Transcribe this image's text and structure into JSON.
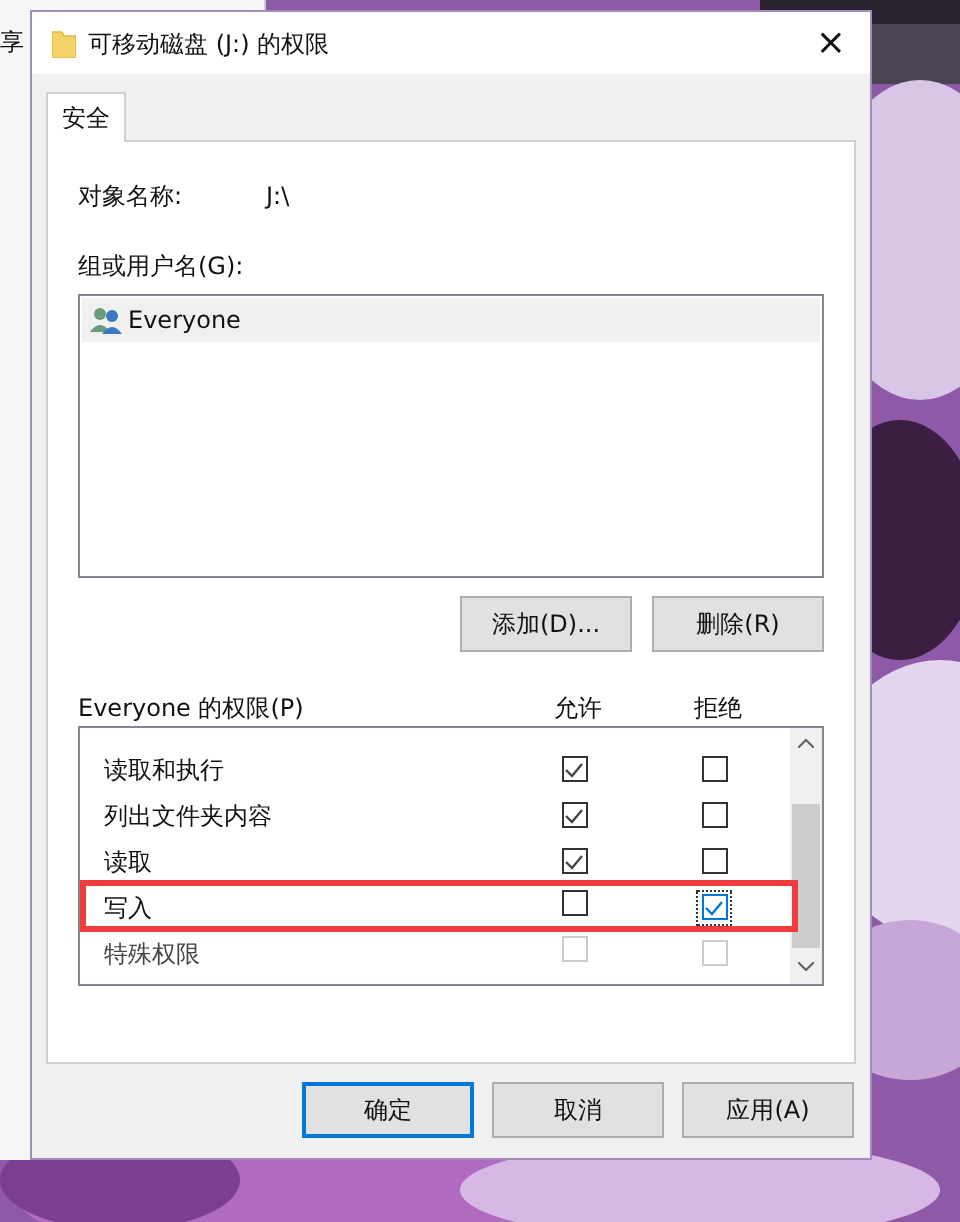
{
  "background_window": {
    "label": "享"
  },
  "dialog": {
    "title": "可移动磁盘 (J:) 的权限",
    "close": "×"
  },
  "tabs": [
    {
      "label": "安全",
      "selected": true
    }
  ],
  "object_name": {
    "label": "对象名称:",
    "value": "J:\\"
  },
  "group": {
    "label": "组或用户名(G):",
    "users": [
      {
        "name": "Everyone",
        "selected": true
      }
    ],
    "buttons": [
      "添加(D)...",
      "删除(R)"
    ]
  },
  "permissions": {
    "label": "Everyone 的权限(P)",
    "columns": [
      "允许",
      "拒绝"
    ],
    "rows": [
      {
        "kind": "full",
        "label": "读取和执行",
        "allow": true,
        "deny": false,
        "disabled": false,
        "highlighted": false,
        "focused": false
      },
      {
        "kind": "full",
        "label": "列出文件夹内容",
        "allow": true,
        "deny": false,
        "disabled": false,
        "highlighted": false,
        "focused": false
      },
      {
        "kind": "full",
        "label": "读取",
        "allow": true,
        "deny": false,
        "disabled": false,
        "highlighted": false,
        "focused": false
      },
      {
        "kind": "full",
        "label": "写入",
        "allow": false,
        "deny": true,
        "disabled": false,
        "highlighted": true,
        "focused": true
      },
      {
        "kind": "full",
        "label": "特殊权限",
        "allow": false,
        "deny": false,
        "disabled": true,
        "highlighted": false,
        "focused": false
      }
    ]
  },
  "footer_buttons": [
    {
      "label": "确定",
      "selected": true
    },
    {
      "label": "取消",
      "selected": false
    },
    {
      "label": "应用(A)",
      "selected": false
    }
  ]
}
